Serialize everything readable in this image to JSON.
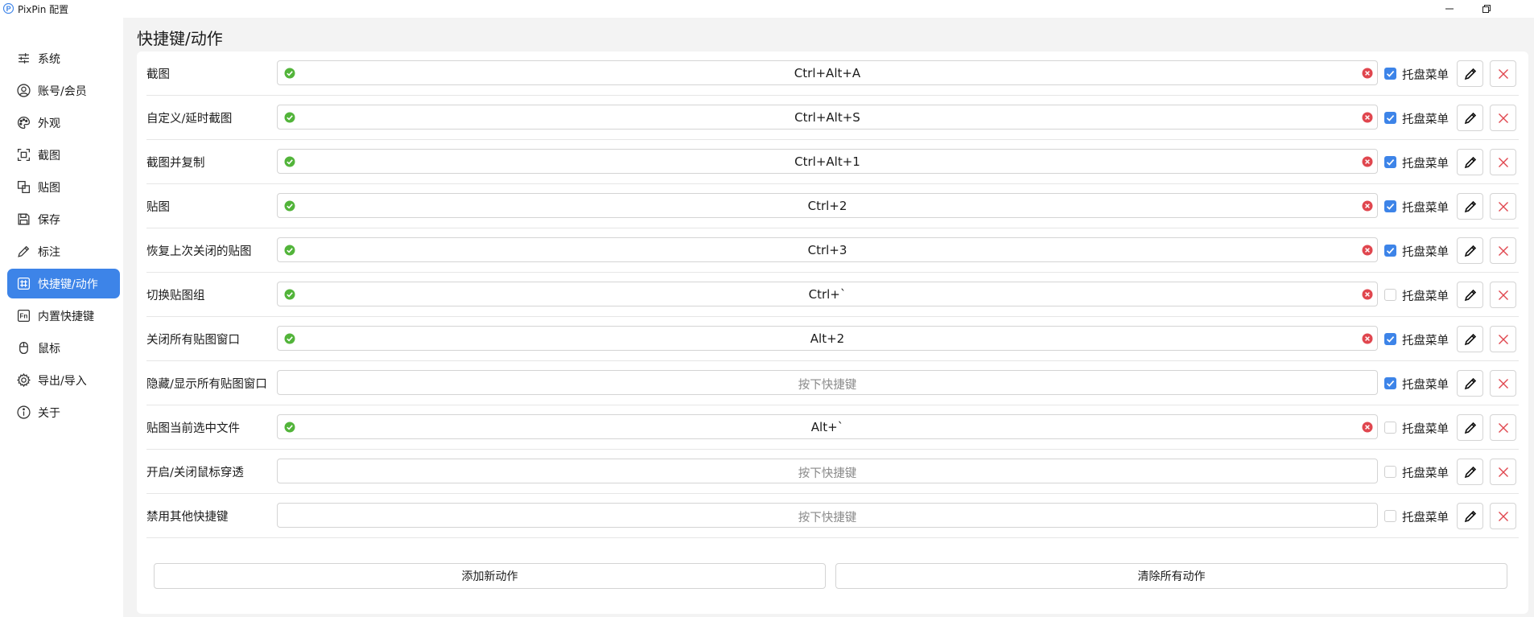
{
  "window": {
    "title": "PixPin 配置"
  },
  "sidebar": {
    "items": [
      {
        "label": "系统",
        "icon": "sliders-icon",
        "active": false
      },
      {
        "label": "账号/会员",
        "icon": "user-icon",
        "active": false
      },
      {
        "label": "外观",
        "icon": "palette-icon",
        "active": false
      },
      {
        "label": "截图",
        "icon": "screenshot-icon",
        "active": false
      },
      {
        "label": "贴图",
        "icon": "pin-copy-icon",
        "active": false
      },
      {
        "label": "保存",
        "icon": "save-icon",
        "active": false
      },
      {
        "label": "标注",
        "icon": "pencil-icon",
        "active": false
      },
      {
        "label": "快捷键/动作",
        "icon": "hash-icon",
        "active": true
      },
      {
        "label": "内置快捷键",
        "icon": "fn-key-icon",
        "active": false
      },
      {
        "label": "鼠标",
        "icon": "mouse-icon",
        "active": false
      },
      {
        "label": "导出/导入",
        "icon": "gear-icon",
        "active": false
      },
      {
        "label": "关于",
        "icon": "info-icon",
        "active": false
      }
    ]
  },
  "page": {
    "title": "快捷键/动作"
  },
  "shortcuts": {
    "tray_menu_label": "托盘菜单",
    "placeholder": "按下快捷键",
    "rows": [
      {
        "label": "截图",
        "shortcut": "Ctrl+Alt+A",
        "tray_menu": true
      },
      {
        "label": "自定义/延时截图",
        "shortcut": "Ctrl+Alt+S",
        "tray_menu": true
      },
      {
        "label": "截图并复制",
        "shortcut": "Ctrl+Alt+1",
        "tray_menu": true
      },
      {
        "label": "贴图",
        "shortcut": "Ctrl+2",
        "tray_menu": true
      },
      {
        "label": "恢复上次关闭的贴图",
        "shortcut": "Ctrl+3",
        "tray_menu": true
      },
      {
        "label": "切换贴图组",
        "shortcut": "Ctrl+`",
        "tray_menu": false
      },
      {
        "label": "关闭所有贴图窗口",
        "shortcut": "Alt+2",
        "tray_menu": true
      },
      {
        "label": "隐藏/显示所有贴图窗口",
        "shortcut": "",
        "tray_menu": true
      },
      {
        "label": "贴图当前选中文件",
        "shortcut": "Alt+`",
        "tray_menu": false
      },
      {
        "label": "开启/关闭鼠标穿透",
        "shortcut": "",
        "tray_menu": false
      },
      {
        "label": "禁用其他快捷键",
        "shortcut": "",
        "tray_menu": false
      }
    ]
  },
  "actions": {
    "add_label": "添加新动作",
    "clear_label": "清除所有动作"
  },
  "colors": {
    "accent": "#3d84e8",
    "ok_green": "#52b43a",
    "clear_red": "#e0464e",
    "delete_red": "#e0464e"
  }
}
